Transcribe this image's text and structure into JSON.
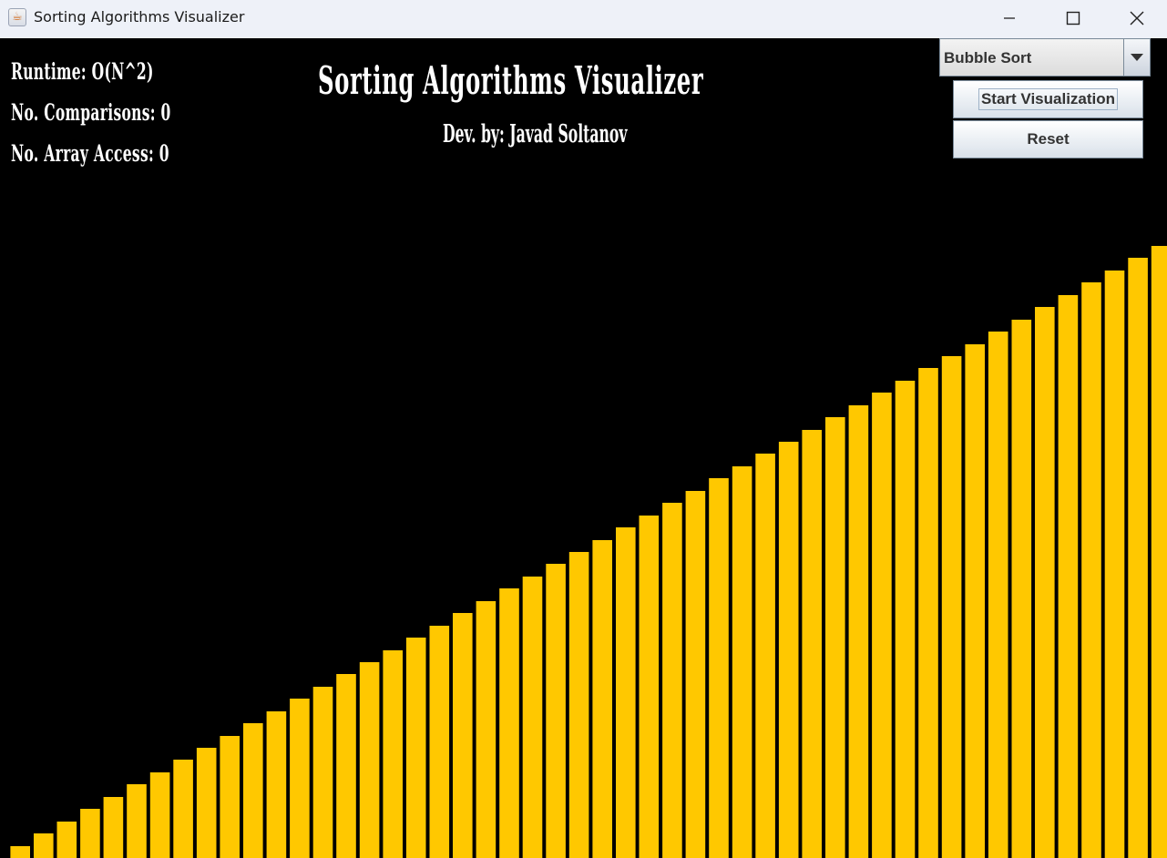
{
  "window": {
    "title": "Sorting Algorithms Visualizer",
    "controls": [
      "minimize-icon",
      "maximize-icon",
      "close-icon"
    ]
  },
  "stats": {
    "runtime": "Runtime: O(N^2)",
    "comparisons": "No. Comparisons: 0",
    "array_access": "No. Array Access: 0"
  },
  "header": {
    "title": "Sorting Algorithms Visualizer",
    "subtitle": "Dev. by: Javad Soltanov"
  },
  "controls": {
    "algorithm_selected": "Bubble Sort",
    "start_label": "Start Visualization",
    "reset_label": "Reset"
  },
  "colors": {
    "background": "#000000",
    "bar": "#ffc800",
    "text": "#ffffff"
  },
  "visualizer": {
    "bar_count": 50,
    "order": "ascending",
    "values": [
      1,
      2,
      3,
      4,
      5,
      6,
      7,
      8,
      9,
      10,
      11,
      12,
      13,
      14,
      15,
      16,
      17,
      18,
      19,
      20,
      21,
      22,
      23,
      24,
      25,
      26,
      27,
      28,
      29,
      30,
      31,
      32,
      33,
      34,
      35,
      36,
      37,
      38,
      39,
      40,
      41,
      42,
      43,
      44,
      45,
      46,
      47,
      48,
      49,
      50
    ]
  }
}
